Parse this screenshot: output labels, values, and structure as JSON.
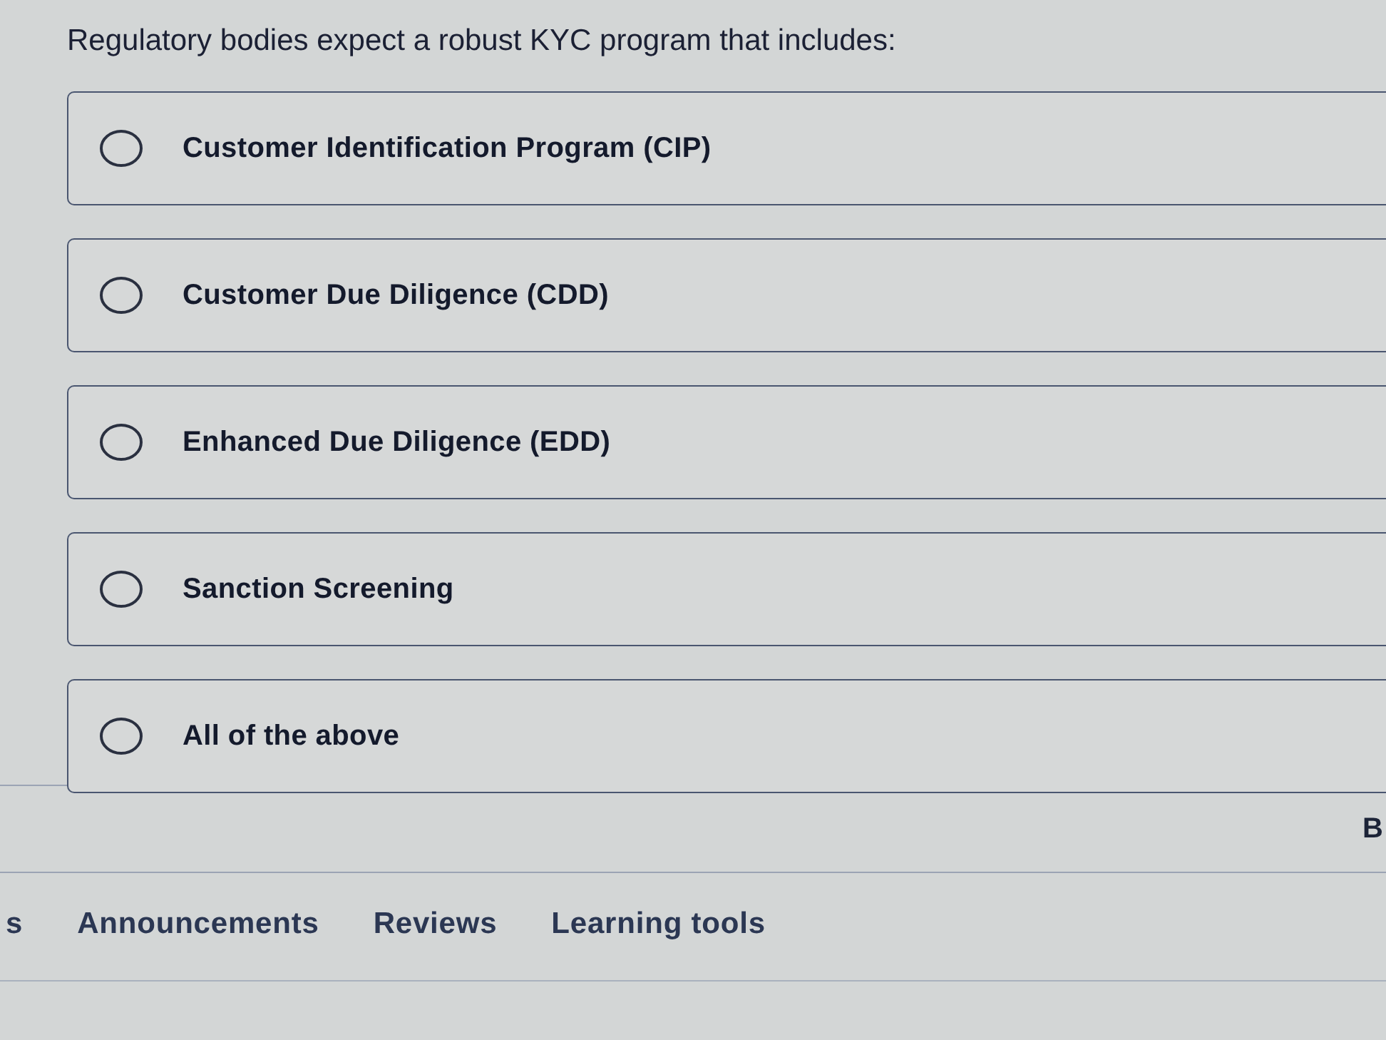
{
  "question": {
    "text": "Regulatory bodies expect a robust KYC program that includes:"
  },
  "options": [
    {
      "label": "Customer Identification Program (CIP)",
      "selected": false
    },
    {
      "label": "Customer Due Diligence (CDD)",
      "selected": false
    },
    {
      "label": "Enhanced Due Diligence (EDD)",
      "selected": false
    },
    {
      "label": "Sanction Screening",
      "selected": false
    },
    {
      "label": "All of the above",
      "selected": false
    }
  ],
  "partial_button": {
    "label": "B"
  },
  "tabs": [
    {
      "label": "s",
      "selected": false
    },
    {
      "label": "Announcements",
      "selected": false
    },
    {
      "label": "Reviews",
      "selected": false
    },
    {
      "label": "Learning tools",
      "selected": false
    }
  ]
}
